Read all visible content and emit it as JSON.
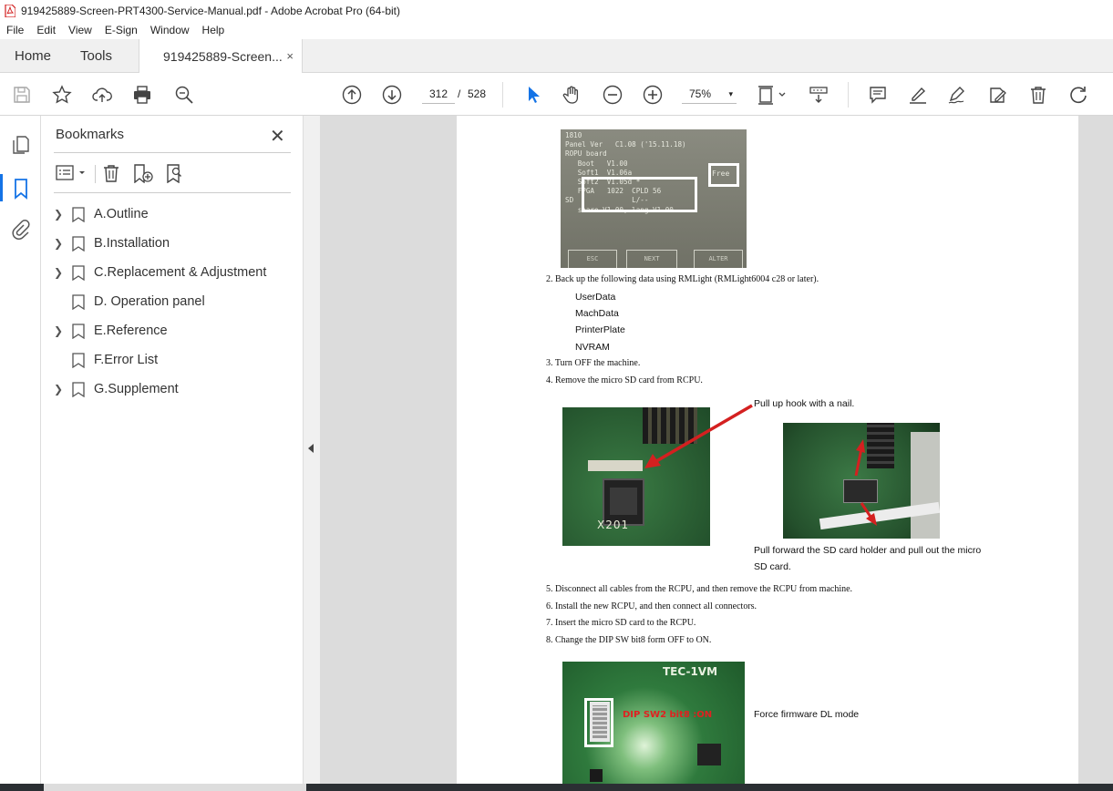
{
  "window": {
    "title": "919425889-Screen-PRT4300-Service-Manual.pdf - Adobe Acrobat Pro (64-bit)"
  },
  "menu": [
    "File",
    "Edit",
    "View",
    "E-Sign",
    "Window",
    "Help"
  ],
  "tabs": {
    "home": "Home",
    "tools": "Tools",
    "document": "919425889-Screen...",
    "close": "×"
  },
  "toolbar": {
    "page_current": "312",
    "page_sep": "/",
    "page_total": "528",
    "zoom": "75%",
    "zoom_caret": "▾"
  },
  "bookmarks": {
    "title": "Bookmarks",
    "close": "✕",
    "items": [
      {
        "label": "A.Outline",
        "expandable": true
      },
      {
        "label": "B.Installation",
        "expandable": true
      },
      {
        "label": "C.Replacement & Adjustment",
        "expandable": true
      },
      {
        "label": "D. Operation panel",
        "expandable": false
      },
      {
        "label": "E.Reference",
        "expandable": true
      },
      {
        "label": "F.Error List",
        "expandable": false
      },
      {
        "label": "G.Supplement",
        "expandable": true
      }
    ]
  },
  "page": {
    "screen_photo": {
      "lines": [
        "1810",
        "Panel Ver   C1.08 ('15.11.18)",
        "ROPU board",
        "   Boot   V1.00",
        "   Soft1  V1.06a",
        "   Soft2  V1.05d *",
        "   FPGA   1022  CPLD 56",
        "SD              L/--",
        "   share V1.00, lang V1.00"
      ],
      "free_label": "Free",
      "buttons": [
        "ESC",
        "NEXT",
        "ALTER"
      ]
    },
    "step2": "2. Back up the following data using RMLight (RMLight6004 c28 or later).",
    "backup_items": [
      "UserData",
      "MachData",
      "PrinterPlate",
      "NVRAM"
    ],
    "step3": "3. Turn OFF the machine.",
    "step4": "4. Remove the micro SD card from RCPU.",
    "caption_hook": "Pull up hook with a nail.",
    "caption_pull": [
      "Pull forward the SD card holder and pull out the micro",
      "SD card."
    ],
    "board_label": "X201",
    "step5": "5. Disconnect all cables from the RCPU, and then remove the RCPU from machine.",
    "step6": "6. Install the new RCPU, and then connect all connectors.",
    "step7": "7. Insert the micro SD card to the RCPU.",
    "step8": "8. Change the DIP SW bit8 form OFF to ON.",
    "dip_label": "DIP SW2 bit8 :ON",
    "board2_label": "TEC-1VM",
    "caption_force": "Force firmware DL mode"
  },
  "colors": {
    "accent": "#1473e6",
    "pcb_green": "#2f6b3a",
    "arrow_red": "#d42020"
  }
}
